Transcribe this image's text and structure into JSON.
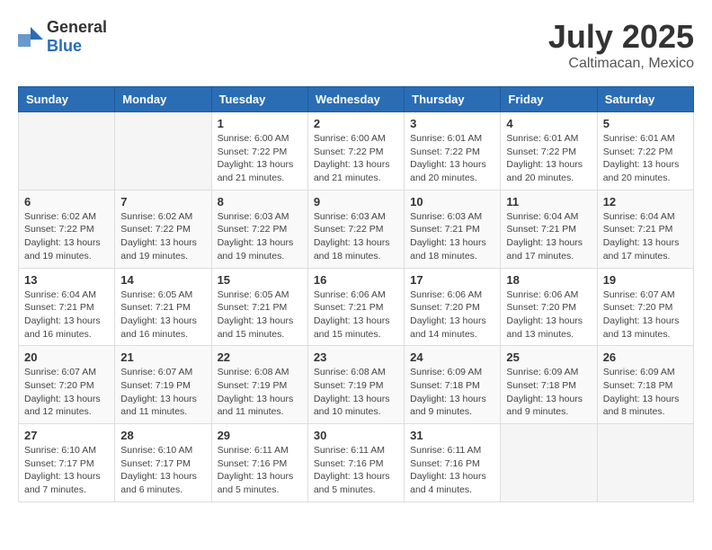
{
  "header": {
    "logo_general": "General",
    "logo_blue": "Blue",
    "month": "July 2025",
    "location": "Caltimacan, Mexico"
  },
  "weekdays": [
    "Sunday",
    "Monday",
    "Tuesday",
    "Wednesday",
    "Thursday",
    "Friday",
    "Saturday"
  ],
  "weeks": [
    [
      {
        "day": "",
        "info": ""
      },
      {
        "day": "",
        "info": ""
      },
      {
        "day": "1",
        "info": "Sunrise: 6:00 AM\nSunset: 7:22 PM\nDaylight: 13 hours and 21 minutes."
      },
      {
        "day": "2",
        "info": "Sunrise: 6:00 AM\nSunset: 7:22 PM\nDaylight: 13 hours and 21 minutes."
      },
      {
        "day": "3",
        "info": "Sunrise: 6:01 AM\nSunset: 7:22 PM\nDaylight: 13 hours and 20 minutes."
      },
      {
        "day": "4",
        "info": "Sunrise: 6:01 AM\nSunset: 7:22 PM\nDaylight: 13 hours and 20 minutes."
      },
      {
        "day": "5",
        "info": "Sunrise: 6:01 AM\nSunset: 7:22 PM\nDaylight: 13 hours and 20 minutes."
      }
    ],
    [
      {
        "day": "6",
        "info": "Sunrise: 6:02 AM\nSunset: 7:22 PM\nDaylight: 13 hours and 19 minutes."
      },
      {
        "day": "7",
        "info": "Sunrise: 6:02 AM\nSunset: 7:22 PM\nDaylight: 13 hours and 19 minutes."
      },
      {
        "day": "8",
        "info": "Sunrise: 6:03 AM\nSunset: 7:22 PM\nDaylight: 13 hours and 19 minutes."
      },
      {
        "day": "9",
        "info": "Sunrise: 6:03 AM\nSunset: 7:22 PM\nDaylight: 13 hours and 18 minutes."
      },
      {
        "day": "10",
        "info": "Sunrise: 6:03 AM\nSunset: 7:21 PM\nDaylight: 13 hours and 18 minutes."
      },
      {
        "day": "11",
        "info": "Sunrise: 6:04 AM\nSunset: 7:21 PM\nDaylight: 13 hours and 17 minutes."
      },
      {
        "day": "12",
        "info": "Sunrise: 6:04 AM\nSunset: 7:21 PM\nDaylight: 13 hours and 17 minutes."
      }
    ],
    [
      {
        "day": "13",
        "info": "Sunrise: 6:04 AM\nSunset: 7:21 PM\nDaylight: 13 hours and 16 minutes."
      },
      {
        "day": "14",
        "info": "Sunrise: 6:05 AM\nSunset: 7:21 PM\nDaylight: 13 hours and 16 minutes."
      },
      {
        "day": "15",
        "info": "Sunrise: 6:05 AM\nSunset: 7:21 PM\nDaylight: 13 hours and 15 minutes."
      },
      {
        "day": "16",
        "info": "Sunrise: 6:06 AM\nSunset: 7:21 PM\nDaylight: 13 hours and 15 minutes."
      },
      {
        "day": "17",
        "info": "Sunrise: 6:06 AM\nSunset: 7:20 PM\nDaylight: 13 hours and 14 minutes."
      },
      {
        "day": "18",
        "info": "Sunrise: 6:06 AM\nSunset: 7:20 PM\nDaylight: 13 hours and 13 minutes."
      },
      {
        "day": "19",
        "info": "Sunrise: 6:07 AM\nSunset: 7:20 PM\nDaylight: 13 hours and 13 minutes."
      }
    ],
    [
      {
        "day": "20",
        "info": "Sunrise: 6:07 AM\nSunset: 7:20 PM\nDaylight: 13 hours and 12 minutes."
      },
      {
        "day": "21",
        "info": "Sunrise: 6:07 AM\nSunset: 7:19 PM\nDaylight: 13 hours and 11 minutes."
      },
      {
        "day": "22",
        "info": "Sunrise: 6:08 AM\nSunset: 7:19 PM\nDaylight: 13 hours and 11 minutes."
      },
      {
        "day": "23",
        "info": "Sunrise: 6:08 AM\nSunset: 7:19 PM\nDaylight: 13 hours and 10 minutes."
      },
      {
        "day": "24",
        "info": "Sunrise: 6:09 AM\nSunset: 7:18 PM\nDaylight: 13 hours and 9 minutes."
      },
      {
        "day": "25",
        "info": "Sunrise: 6:09 AM\nSunset: 7:18 PM\nDaylight: 13 hours and 9 minutes."
      },
      {
        "day": "26",
        "info": "Sunrise: 6:09 AM\nSunset: 7:18 PM\nDaylight: 13 hours and 8 minutes."
      }
    ],
    [
      {
        "day": "27",
        "info": "Sunrise: 6:10 AM\nSunset: 7:17 PM\nDaylight: 13 hours and 7 minutes."
      },
      {
        "day": "28",
        "info": "Sunrise: 6:10 AM\nSunset: 7:17 PM\nDaylight: 13 hours and 6 minutes."
      },
      {
        "day": "29",
        "info": "Sunrise: 6:11 AM\nSunset: 7:16 PM\nDaylight: 13 hours and 5 minutes."
      },
      {
        "day": "30",
        "info": "Sunrise: 6:11 AM\nSunset: 7:16 PM\nDaylight: 13 hours and 5 minutes."
      },
      {
        "day": "31",
        "info": "Sunrise: 6:11 AM\nSunset: 7:16 PM\nDaylight: 13 hours and 4 minutes."
      },
      {
        "day": "",
        "info": ""
      },
      {
        "day": "",
        "info": ""
      }
    ]
  ]
}
